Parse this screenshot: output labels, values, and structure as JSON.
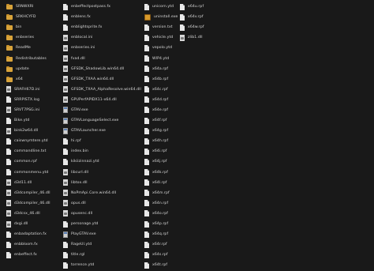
{
  "columns": [
    {
      "files": [
        {
          "name": "SRNWXRI",
          "icon": "folder-icon"
        },
        {
          "name": "SRKHCYFD",
          "icon": "folder-icon"
        },
        {
          "name": "bin",
          "icon": "folder-icon"
        },
        {
          "name": "enbseries",
          "icon": "folder-icon"
        },
        {
          "name": "ReadMe",
          "icon": "folder-icon"
        },
        {
          "name": "Redistributables",
          "icon": "folder-icon"
        },
        {
          "name": "update",
          "icon": "folder-icon"
        },
        {
          "name": "x64",
          "icon": "folder-icon"
        },
        {
          "name": "SRAFH67D.ini",
          "icon": "settings-file-icon"
        },
        {
          "name": "SRRPISTX.log",
          "icon": "document-icon"
        },
        {
          "name": "SRVT7PSG.ini",
          "icon": "settings-file-icon"
        },
        {
          "name": "Bike.ytd",
          "icon": "document-icon"
        },
        {
          "name": "bink2w64.dll",
          "icon": "settings-file-icon"
        },
        {
          "name": "caiswnymtere.ytd",
          "icon": "document-icon"
        },
        {
          "name": "commandline.txt",
          "icon": "document-icon"
        },
        {
          "name": "common.rpf",
          "icon": "document-icon"
        },
        {
          "name": "commonmenu.ytd",
          "icon": "document-icon"
        },
        {
          "name": "d3d11.dll",
          "icon": "settings-file-icon"
        },
        {
          "name": "d3dcompiler_46.dll",
          "icon": "settings-file-icon"
        },
        {
          "name": "d3dcompiler_46.dll",
          "icon": "settings-file-icon"
        },
        {
          "name": "d3dcsx_46.dll",
          "icon": "settings-file-icon"
        },
        {
          "name": "dxgi.dll",
          "icon": "settings-file-icon"
        },
        {
          "name": "enbadaptation.fx",
          "icon": "document-icon"
        },
        {
          "name": "enbbloom.fx",
          "icon": "document-icon"
        },
        {
          "name": "enbeffect.fx",
          "icon": "document-icon"
        }
      ]
    },
    {
      "files": [
        {
          "name": "enbeffectpostpass.fx",
          "icon": "document-icon"
        },
        {
          "name": "enblens.fx",
          "icon": "document-icon"
        },
        {
          "name": "enblightsprite.fx",
          "icon": "document-icon"
        },
        {
          "name": "enblocal.ini",
          "icon": "settings-file-icon"
        },
        {
          "name": "enbseries.ini",
          "icon": "settings-file-icon"
        },
        {
          "name": "fvad.dll",
          "icon": "settings-file-icon"
        },
        {
          "name": "GFSDK_ShadowLib.win64.dll",
          "icon": "settings-file-icon"
        },
        {
          "name": "GFSDK_TXAA.win64.dll",
          "icon": "settings-file-icon"
        },
        {
          "name": "GFSDK_TXAA_AlphaResolve.win64.dll",
          "icon": "settings-file-icon"
        },
        {
          "name": "GPUPerfAPIDX11-x64.dll",
          "icon": "settings-file-icon"
        },
        {
          "name": "GTAV.exe",
          "icon": "application-icon"
        },
        {
          "name": "GTAVLanguageSelect.exe",
          "icon": "application-icon"
        },
        {
          "name": "GTAVLauncher.exe",
          "icon": "application-icon"
        },
        {
          "name": "hi.rpf",
          "icon": "document-icon"
        },
        {
          "name": "index.bin",
          "icon": "document-icon"
        },
        {
          "name": "kikiizinnazi.ytd",
          "icon": "document-icon"
        },
        {
          "name": "libcurl.dll",
          "icon": "settings-file-icon"
        },
        {
          "name": "libtox.dll",
          "icon": "settings-file-icon"
        },
        {
          "name": "NoPmApi.Core.win64.dll",
          "icon": "settings-file-icon"
        },
        {
          "name": "opus.dll",
          "icon": "settings-file-icon"
        },
        {
          "name": "opusenc.dll",
          "icon": "settings-file-icon"
        },
        {
          "name": "personage.ytd",
          "icon": "document-icon"
        },
        {
          "name": "PlayGTAV.exe",
          "icon": "application-icon"
        },
        {
          "name": "RageUI.ytd",
          "icon": "document-icon"
        },
        {
          "name": "title.rgl",
          "icon": "document-icon"
        },
        {
          "name": "torrence.ytd",
          "icon": "document-icon"
        }
      ]
    },
    {
      "files": [
        {
          "name": "unicorn.ytd",
          "icon": "document-icon"
        },
        {
          "name": "uninstall.exe",
          "icon": "installer-icon"
        },
        {
          "name": "version.txt",
          "icon": "document-icon"
        },
        {
          "name": "vehicle.ytd",
          "icon": "document-icon"
        },
        {
          "name": "vepolo.ytd",
          "icon": "document-icon"
        },
        {
          "name": "WIP4.ytd",
          "icon": "document-icon"
        },
        {
          "name": "x64a.rpf",
          "icon": "document-icon"
        },
        {
          "name": "x64b.rpf",
          "icon": "document-icon"
        },
        {
          "name": "x64c.rpf",
          "icon": "document-icon"
        },
        {
          "name": "x64d.rpf",
          "icon": "document-icon"
        },
        {
          "name": "x64e.rpf",
          "icon": "document-icon"
        },
        {
          "name": "x64f.rpf",
          "icon": "document-icon"
        },
        {
          "name": "x64g.rpf",
          "icon": "document-icon"
        },
        {
          "name": "x64h.rpf",
          "icon": "document-icon"
        },
        {
          "name": "x64i.rpf",
          "icon": "document-icon"
        },
        {
          "name": "x64j.rpf",
          "icon": "document-icon"
        },
        {
          "name": "x64k.rpf",
          "icon": "document-icon"
        },
        {
          "name": "x64l.rpf",
          "icon": "document-icon"
        },
        {
          "name": "x64m.rpf",
          "icon": "document-icon"
        },
        {
          "name": "x64n.rpf",
          "icon": "document-icon"
        },
        {
          "name": "x64o.rpf",
          "icon": "document-icon"
        },
        {
          "name": "x64p.rpf",
          "icon": "document-icon"
        },
        {
          "name": "x64q.rpf",
          "icon": "document-icon"
        },
        {
          "name": "x64r.rpf",
          "icon": "document-icon"
        },
        {
          "name": "x64s.rpf",
          "icon": "document-icon"
        },
        {
          "name": "x64t.rpf",
          "icon": "document-icon"
        }
      ]
    },
    {
      "files": [
        {
          "name": "x64u.rpf",
          "icon": "document-icon"
        },
        {
          "name": "x64v.rpf",
          "icon": "document-icon"
        },
        {
          "name": "x64w.rpf",
          "icon": "document-icon"
        },
        {
          "name": "zlib1.dll",
          "icon": "settings-file-icon"
        }
      ]
    }
  ]
}
